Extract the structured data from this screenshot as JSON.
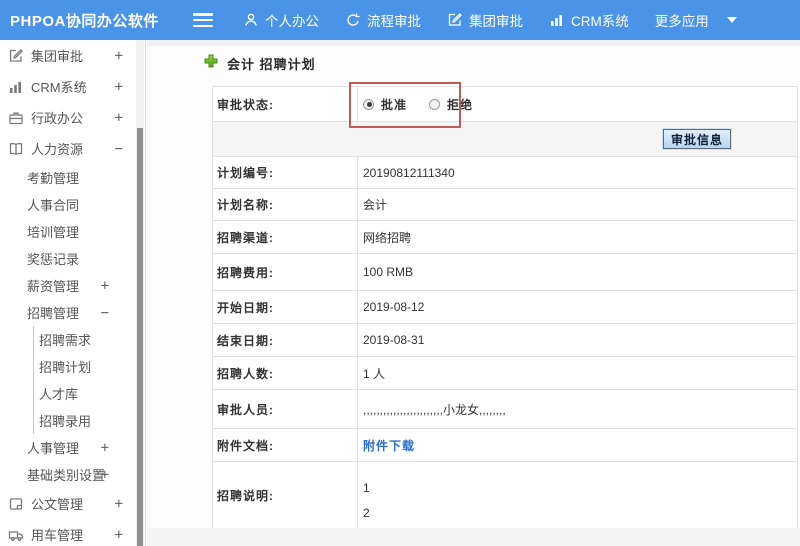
{
  "navbar": {
    "logo": "PHPOA协同办公软件",
    "items": [
      {
        "label": "个人办公",
        "icon": "user-icon"
      },
      {
        "label": "流程审批",
        "icon": "process-arrow-icon"
      },
      {
        "label": "集团审批",
        "icon": "edit-square-icon"
      },
      {
        "label": "CRM系统",
        "icon": "bar-chart-icon"
      },
      {
        "label": "更多应用",
        "icon": "caret-down-icon"
      }
    ]
  },
  "sidebar": {
    "items": [
      {
        "label": "集团审批",
        "level": 1,
        "icon": "edit-square-icon",
        "expand": "+"
      },
      {
        "label": "CRM系统",
        "level": 1,
        "icon": "bar-chart-icon",
        "expand": "+"
      },
      {
        "label": "行政办公",
        "level": 1,
        "icon": "briefcase-icon",
        "expand": "+"
      },
      {
        "label": "人力资源",
        "level": 1,
        "icon": "book-icon",
        "expand": "−"
      },
      {
        "label": "考勤管理",
        "level": 2,
        "expand": ""
      },
      {
        "label": "人事合同",
        "level": 2,
        "expand": ""
      },
      {
        "label": "培训管理",
        "level": 2,
        "expand": ""
      },
      {
        "label": "奖惩记录",
        "level": 2,
        "expand": ""
      },
      {
        "label": "薪资管理",
        "level": 2,
        "expand": "+"
      },
      {
        "label": "招聘管理",
        "level": 2,
        "expand": "−"
      },
      {
        "label": "招聘需求",
        "level": 3,
        "expand": ""
      },
      {
        "label": "招聘计划",
        "level": 3,
        "expand": ""
      },
      {
        "label": "人才库",
        "level": 3,
        "expand": ""
      },
      {
        "label": "招聘录用",
        "level": 3,
        "expand": ""
      },
      {
        "label": "人事管理",
        "level": 2,
        "expand": "+"
      },
      {
        "label": "基础类别设置",
        "level": 2,
        "expand": "+"
      },
      {
        "label": "公文管理",
        "level": 1,
        "icon": "document-icon",
        "expand": "+"
      },
      {
        "label": "用车管理",
        "level": 1,
        "icon": "truck-icon",
        "expand": "+"
      }
    ]
  },
  "main": {
    "title": "会计 招聘计划",
    "title_icon": "add-plus-icon",
    "approval_status_label": "审批状态:",
    "radio_approve": "批准",
    "radio_reject": "拒绝",
    "approve_selected": true,
    "approval_info_button": "审批信息",
    "fields": [
      {
        "label": "计划编号:",
        "value": "20190812111340",
        "type": "text"
      },
      {
        "label": "计划名称:",
        "value": "会计",
        "type": "text"
      },
      {
        "label": "招聘渠道:",
        "value": "网络招聘",
        "type": "text"
      },
      {
        "label": "招聘费用:",
        "value": "100 RMB",
        "type": "text"
      },
      {
        "label": "开始日期:",
        "value": "2019-08-12",
        "type": "text"
      },
      {
        "label": "结束日期:",
        "value": "2019-08-31",
        "type": "text"
      },
      {
        "label": "招聘人数:",
        "value": "1 人",
        "type": "text"
      },
      {
        "label": "审批人员:",
        "value": ",,,,,,,,,,,,,,,,,,,,,,,,小龙女,,,,,,,,",
        "type": "text"
      },
      {
        "label": "附件文档:",
        "value": "附件下载",
        "type": "link"
      },
      {
        "label": "招聘说明:",
        "value": "1 2",
        "type": "multiline",
        "lines": [
          "1",
          "2"
        ]
      }
    ]
  },
  "colors": {
    "navbar_bg": "#4a94e8",
    "navbar_text": "#ffffff",
    "sidebar_text": "#555555",
    "table_border": "#e2e2e2",
    "button_row_bg": "#f5f5f5",
    "link": "#2a70c8",
    "annotation_red": "#c05a58",
    "title_plus_green": "#6abf2e"
  }
}
